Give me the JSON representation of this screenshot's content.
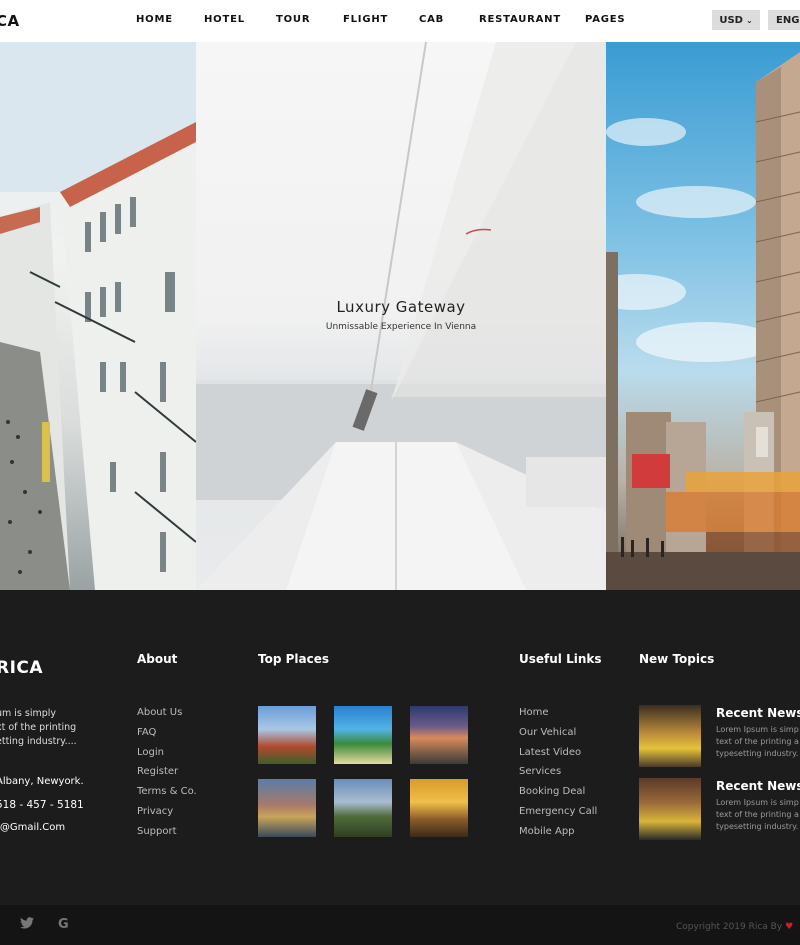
{
  "header": {
    "logo": "CA",
    "nav": [
      "HOME",
      "HOTEL",
      "TOUR",
      "FLIGHT",
      "CAB",
      "RESTAURANT",
      "PAGES"
    ],
    "currency": "USD",
    "language": "ENG"
  },
  "hero": {
    "title": "Luxury Gateway",
    "subtitle": "Unmissable Experience In Vienna"
  },
  "footer": {
    "logo": "RICA",
    "description": [
      "um is simply",
      "xt of the printing",
      "etting industry...."
    ],
    "address": "Albany, Newyork.",
    "phone": "518 - 457 - 5181",
    "email": "t@Gmail.Com",
    "about": {
      "heading": "About",
      "links": [
        "About Us",
        "FAQ",
        "Login",
        "Register",
        "Terms & Co.",
        "Privacy",
        "Support"
      ]
    },
    "top_places": {
      "heading": "Top Places"
    },
    "useful_links": {
      "heading": "Useful Links",
      "links": [
        "Home",
        "Our Vehical",
        "Latest Video",
        "Services",
        "Booking Deal",
        "Emergency Call",
        "Mobile App"
      ]
    },
    "new_topics": {
      "heading": "New Topics",
      "items": [
        {
          "title": "Recent News",
          "text": [
            "Lorem Ipsum is simp",
            "text of the printing a",
            "typesetting industry."
          ]
        },
        {
          "title": "Recent News",
          "text": [
            "Lorem Ipsum is simp",
            "text of the printing a",
            "typesetting industry."
          ]
        }
      ]
    },
    "copyright": "Copyright 2019 Rica By"
  },
  "icons": {
    "twitter": "twitter-icon",
    "google": "google-icon",
    "heart": "heart-icon",
    "caret": "chevron-down-icon"
  },
  "colors": {
    "footer_bg": "#1c1c1c",
    "header_bg": "#ffffff",
    "heart": "#d11a2a"
  }
}
